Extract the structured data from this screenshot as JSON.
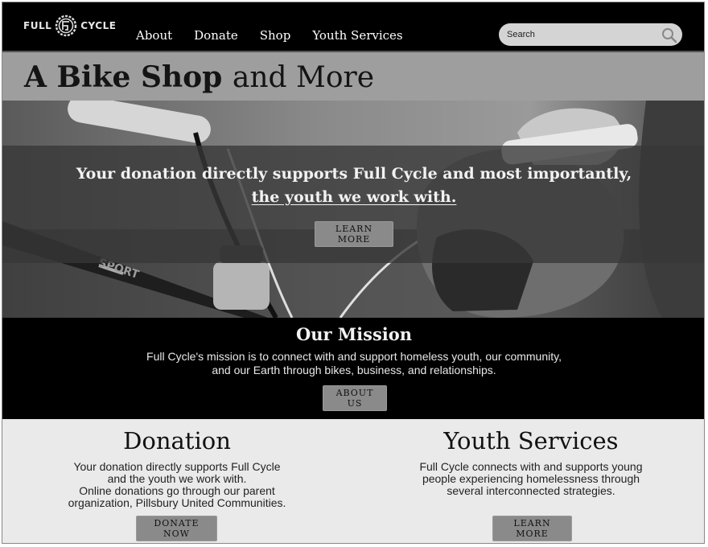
{
  "header": {
    "logo_left": "FULL",
    "logo_right": "CYCLE",
    "nav": [
      "About",
      "Donate",
      "Shop",
      "Youth Services"
    ],
    "search_placeholder": "Search"
  },
  "title": {
    "bold": "A Bike Shop",
    "light": "and More"
  },
  "hero": {
    "line1": "Your donation directly supports Full Cycle and most importantly,",
    "line2": "the youth we work with.",
    "button": "LEARN MORE",
    "frame_text": "SPORT"
  },
  "mission": {
    "heading": "Our Mission",
    "line1": "Full Cycle's mission is to connect with and support homeless youth, our community,",
    "line2": "and our Earth through bikes, business, and relationships.",
    "button": "ABOUT US"
  },
  "donation": {
    "heading": "Donation",
    "lines": [
      "Your donation directly supports Full Cycle",
      "and the youth we work with.",
      "Online donations go through our parent",
      "organization, Pillsbury United Communities."
    ],
    "button": "DONATE NOW"
  },
  "youth_services": {
    "heading": "Youth Services",
    "lines": [
      "Full Cycle connects with and supports young",
      "people experiencing homelessness through",
      "several interconnected strategies."
    ],
    "button": "LEARN MORE"
  },
  "colors": {
    "header_bg": "#000000",
    "title_band": "#9e9e9e",
    "button_bg": "#8a8a8a",
    "section_bg": "#eaeaea"
  }
}
